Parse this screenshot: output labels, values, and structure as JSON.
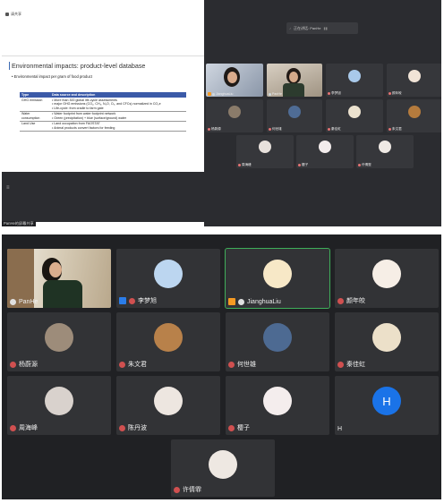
{
  "top": {
    "share_tag": "请共享",
    "sharing_label": "PanHe的屏幕共享",
    "recording_text": "正在讲话: PanHe",
    "slide": {
      "title": "Environmental impacts: product-level database",
      "subtitle": "Environmental impact per gram of food product",
      "headers": [
        "Type",
        "Data source and description"
      ],
      "rows": [
        {
          "type": "GHG emission",
          "items": [
            "More than 300 global life-cycle assessments",
            "major GHG emissions (CO₂, CH₄, N₂O, O₃, and CFCs) normalized in CO₂e",
            "Life-cycle: from cradle to farm gate"
          ]
        },
        {
          "type": "Water consumption",
          "items": [
            "Water footprint from water footprint network",
            "Green (precipitation) + blue (surface/ground) water"
          ]
        },
        {
          "type": "Land Use",
          "items": [
            "Land occupation from FAOSTAT",
            "Animal products convert factors for feeding"
          ]
        }
      ]
    },
    "tiles": [
      {
        "name": "JianghuaLiu"
      },
      {
        "name": "PanHe"
      },
      {
        "name": "李梦旭"
      },
      {
        "name": "颜年皎"
      },
      {
        "name": "杨蔚源"
      },
      {
        "name": "何世雄"
      },
      {
        "name": "秦佳虹"
      },
      {
        "name": "朱文君"
      },
      {
        "name": "周海峰"
      },
      {
        "name": "樱子"
      },
      {
        "name": "许倩霏"
      }
    ]
  },
  "bottom": {
    "tiles": [
      {
        "name": "PanHe"
      },
      {
        "name": "李梦旭"
      },
      {
        "name": "JianghuaLiu"
      },
      {
        "name": "颜年皎"
      },
      {
        "name": "杨蔚源"
      },
      {
        "name": "朱文君"
      },
      {
        "name": "何世雄"
      },
      {
        "name": "秦佳虹"
      },
      {
        "name": "周海峰"
      },
      {
        "name": "陈丹波"
      },
      {
        "name": "樱子"
      },
      {
        "name": "H",
        "initial": "H"
      },
      {
        "name": "许倩霏"
      }
    ]
  },
  "colors": {
    "active_border": "#3fae5a",
    "host_badge": "#f59a23",
    "initial_avatar": "#1a73e8",
    "table_header": "#3b5aa8"
  }
}
